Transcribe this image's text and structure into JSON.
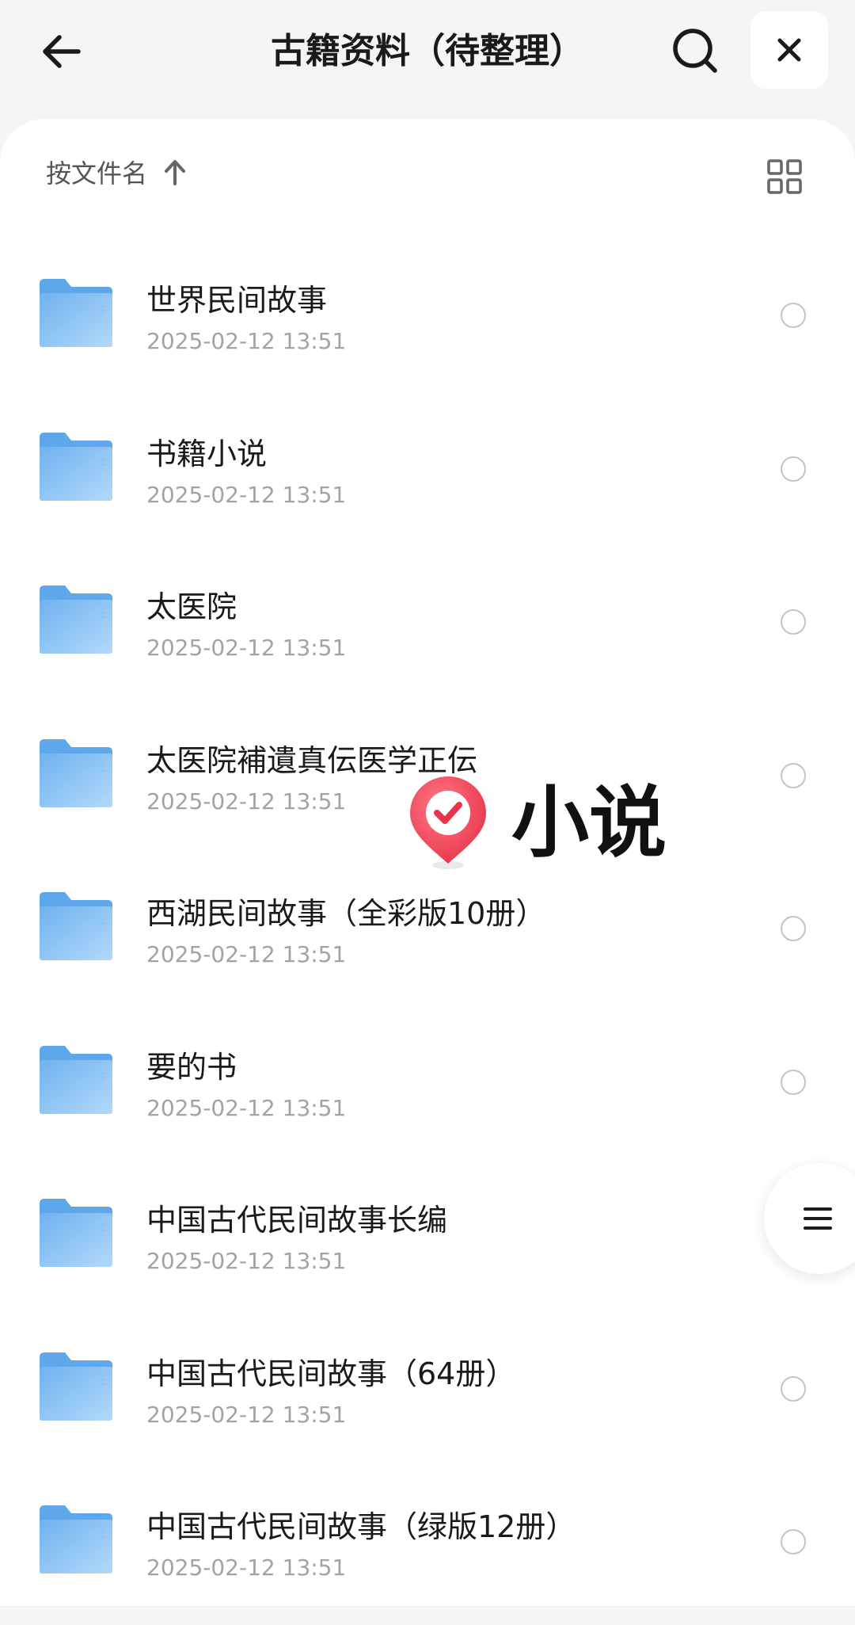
{
  "header": {
    "title": "古籍资料（待整理）",
    "back_icon": "back-arrow-icon",
    "search_icon": "search-icon",
    "close_icon": "close-icon"
  },
  "toolbar": {
    "sort_label": "按文件名",
    "sort_icon": "arrow-up-icon",
    "view_icon": "grid-view-icon"
  },
  "items": [
    {
      "name": "世界民间故事",
      "date": "2025-02-12 13:51"
    },
    {
      "name": "书籍小说",
      "date": "2025-02-12 13:51"
    },
    {
      "name": "太医院",
      "date": "2025-02-12 13:51"
    },
    {
      "name": "太医院補遺真伝医学正伝",
      "date": "2025-02-12 13:51"
    },
    {
      "name": "西湖民间故事（全彩版10册）",
      "date": "2025-02-12 13:51"
    },
    {
      "name": "要的书",
      "date": "2025-02-12 13:51"
    },
    {
      "name": "中国古代民间故事长编",
      "date": "2025-02-12 13:51"
    },
    {
      "name": "中国古代民间故事（64册）",
      "date": "2025-02-12 13:51"
    },
    {
      "name": "中国古代民间故事（绿版12册）",
      "date": "2025-02-12 13:51"
    }
  ],
  "sticker": {
    "text": "小说",
    "icon": "check-pin-icon"
  },
  "floating_menu": {
    "icon": "menu-icon"
  },
  "colors": {
    "folder": "#7fbcf3",
    "folder_light": "#a9d3f8",
    "sticker_red": "#f0485a"
  }
}
